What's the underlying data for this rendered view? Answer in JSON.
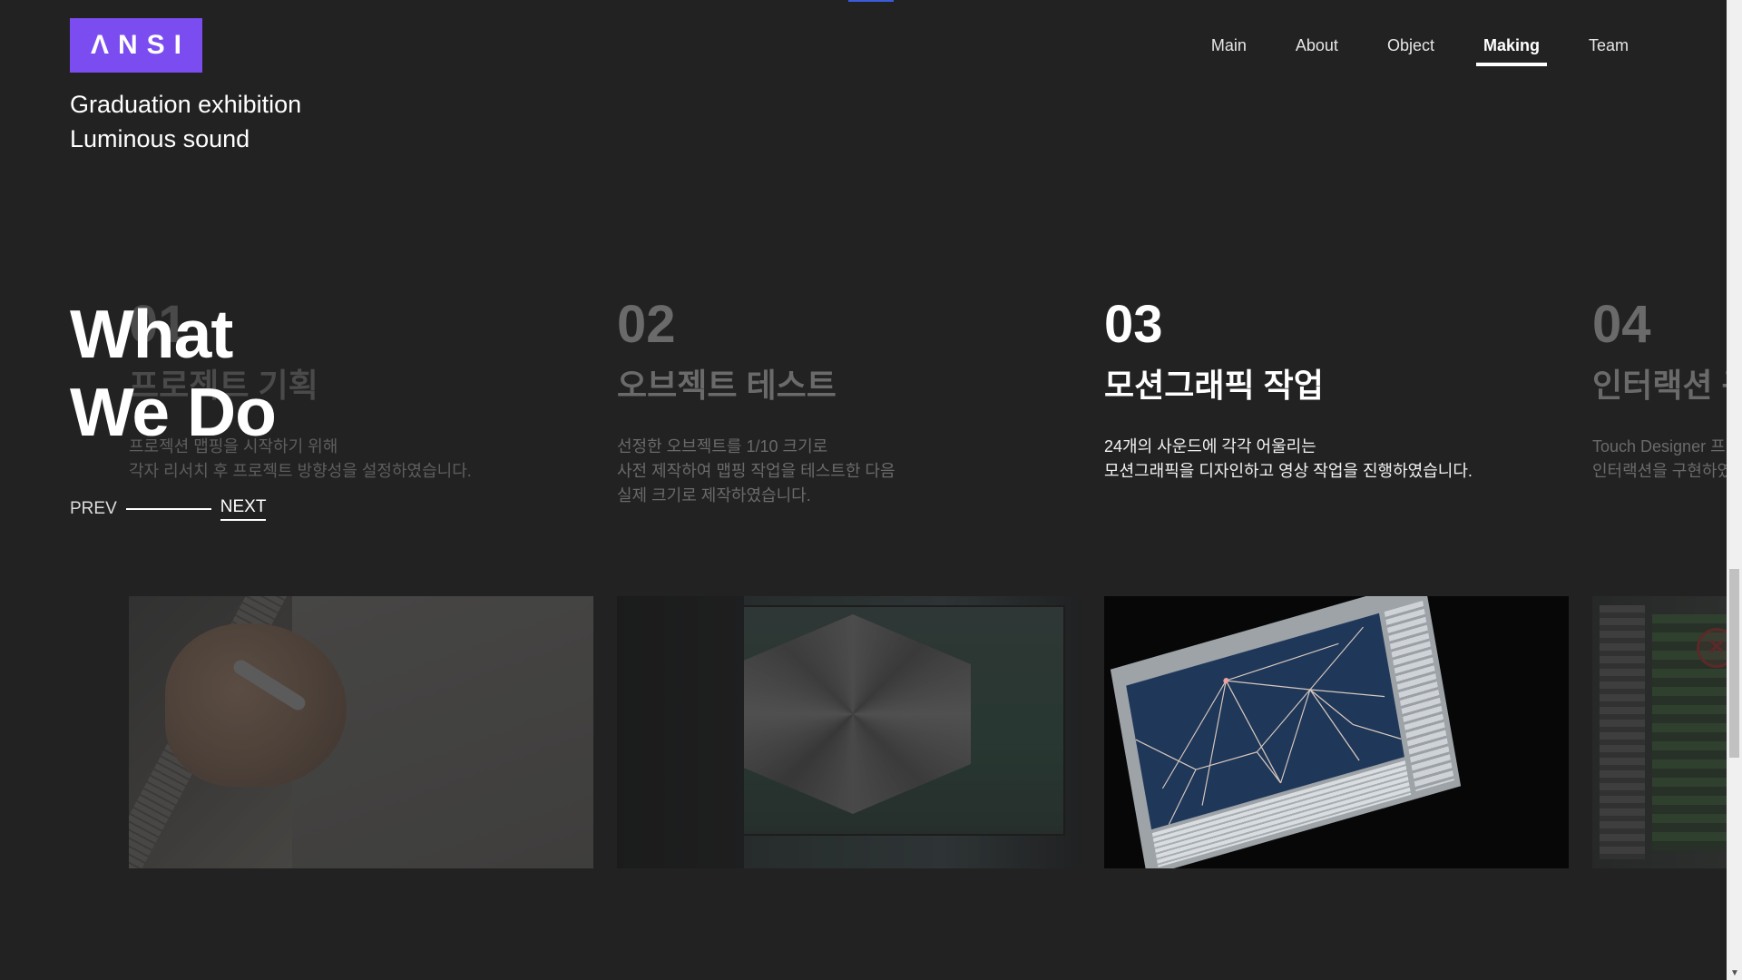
{
  "brand": {
    "logo_text": "ΛNSI",
    "logo_color": "#7b4cf0",
    "subtitle_line1": "Graduation exhibition",
    "subtitle_line2": "Luminous sound"
  },
  "nav": {
    "items": [
      {
        "label": "Main"
      },
      {
        "label": "About"
      },
      {
        "label": "Object"
      },
      {
        "label": "Making",
        "active": true
      },
      {
        "label": "Team"
      }
    ]
  },
  "section": {
    "heading_line1": "What",
    "heading_line2": "We Do",
    "prev_label": "PREV",
    "next_label": "NEXT"
  },
  "slides": [
    {
      "num": "01",
      "title": "프로젝트 기획",
      "desc": [
        "프로젝션 맵핑을 시작하기 위해",
        "각자 리서치 후 프로젝트 방향성을 설정하였습니다."
      ]
    },
    {
      "num": "02",
      "title": "오브젝트 테스트",
      "desc": [
        "선정한 오브젝트를 1/10 크기로",
        "사전 제작하여 맵핑 작업을 테스트한 다음",
        "실제 크기로 제작하였습니다."
      ]
    },
    {
      "num": "03",
      "title": "모션그래픽 작업",
      "desc": [
        "24개의 사운드에 각각 어울리는",
        "모션그래픽을 디자인하고 영상 작업을 진행하였습니다."
      ],
      "active": true
    },
    {
      "num": "04",
      "title": "인터랙션 구",
      "desc": [
        "Touch Designer 프",
        "인터랙션을 구현하였"
      ]
    }
  ],
  "colors": {
    "background": "#222222",
    "inactive_text": "#6a6a6a",
    "active_text": "#ffffff",
    "top_indicator": "#3b5bdb"
  }
}
